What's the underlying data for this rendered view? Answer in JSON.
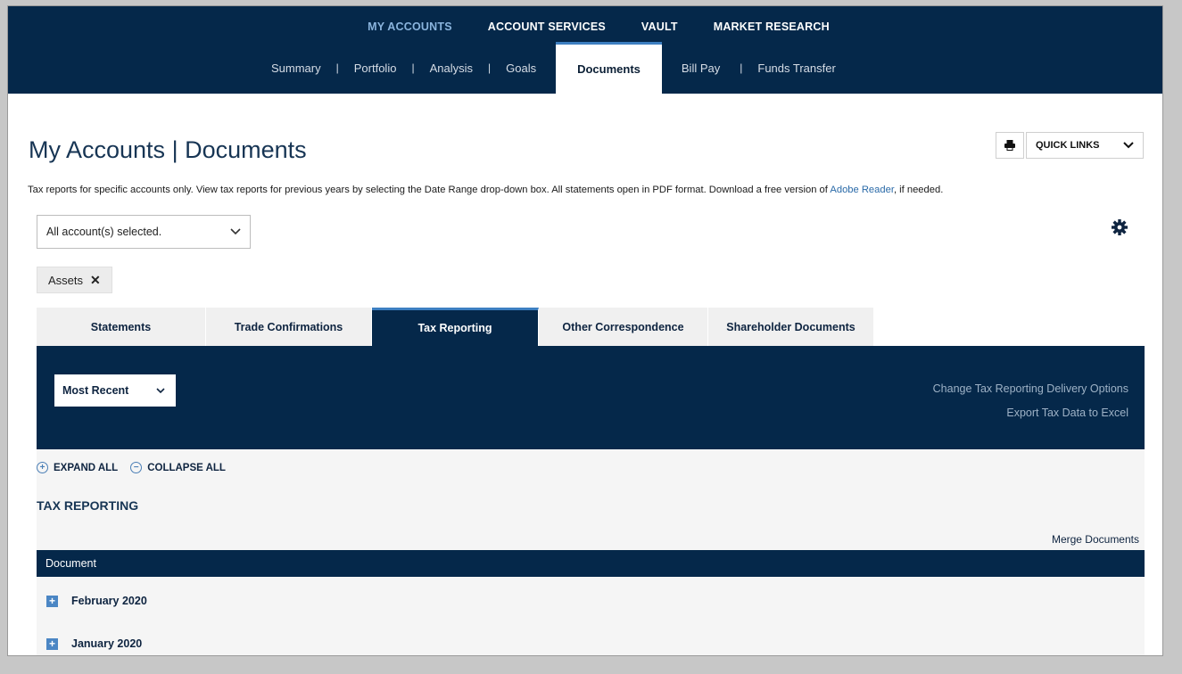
{
  "nav": {
    "primary": [
      "MY ACCOUNTS",
      "ACCOUNT SERVICES",
      "VAULT",
      "MARKET RESEARCH"
    ],
    "secondary": [
      "Summary",
      "Portfolio",
      "Analysis",
      "Goals",
      "Documents",
      "Bill Pay",
      "Funds Transfer"
    ],
    "separator": "|"
  },
  "page": {
    "title": "My Accounts | Documents",
    "quick_links": "QUICK LINKS",
    "description_prefix": "Tax reports for specific accounts only. View tax reports for previous years by selecting the Date Range drop-down box. All statements open in PDF format. Download a free version of ",
    "description_link": "Adobe Reader",
    "description_suffix": ", if needed."
  },
  "filter": {
    "account_select": "All account(s) selected.",
    "pill": "Assets",
    "pill_remove": "✕"
  },
  "tabs": [
    "Statements",
    "Trade Confirmations",
    "Tax Reporting",
    "Other Correspondence",
    "Shareholder Documents"
  ],
  "panel": {
    "date_range": "Most Recent",
    "link1": "Change Tax Reporting Delivery Options",
    "link2": "Export Tax Data to Excel"
  },
  "content": {
    "expand_all": "EXPAND ALL",
    "collapse_all": "COLLAPSE ALL",
    "section_title": "TAX REPORTING",
    "merge": "Merge Documents",
    "column_header": "Document",
    "rows": [
      "February 2020",
      "January 2020"
    ]
  },
  "colors": {
    "navy": "#05284a",
    "accent_blue": "#3d7fc1",
    "link_blue": "#2a6aa8"
  }
}
